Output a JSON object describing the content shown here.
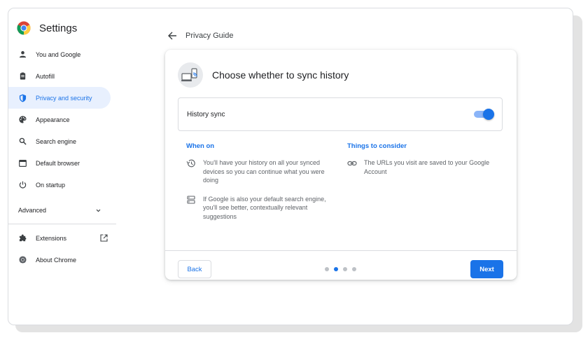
{
  "app": {
    "title": "Settings"
  },
  "sidebar": {
    "items": [
      {
        "label": "You and Google",
        "icon": "person-icon",
        "active": false
      },
      {
        "label": "Autofill",
        "icon": "clipboard-icon",
        "active": false
      },
      {
        "label": "Privacy and security",
        "icon": "shield-icon",
        "active": true
      },
      {
        "label": "Appearance",
        "icon": "palette-icon",
        "active": false
      },
      {
        "label": "Search engine",
        "icon": "search-icon",
        "active": false
      },
      {
        "label": "Default browser",
        "icon": "browser-icon",
        "active": false
      },
      {
        "label": "On startup",
        "icon": "power-icon",
        "active": false
      }
    ],
    "advanced_label": "Advanced",
    "extensions_label": "Extensions",
    "about_label": "About Chrome"
  },
  "breadcrumb": {
    "title": "Privacy Guide"
  },
  "card": {
    "title": "Choose whether to sync history",
    "toggle": {
      "label": "History sync",
      "on": true
    },
    "when_on": {
      "heading": "When on",
      "points": [
        {
          "icon": "history-icon",
          "text": "You'll have your history on all your synced devices so you can continue what you were doing"
        },
        {
          "icon": "search-engine-icon",
          "text": "If Google is also your default search engine, you'll see better, contextually relevant suggestions"
        }
      ]
    },
    "consider": {
      "heading": "Things to consider",
      "points": [
        {
          "icon": "link-icon",
          "text": "The URLs you visit are saved to your Google Account"
        }
      ]
    },
    "footer": {
      "back_label": "Back",
      "next_label": "Next",
      "step_current": 2,
      "step_total": 4
    }
  },
  "colors": {
    "accent": "#1a73e8",
    "active_bg": "#e8f0fe",
    "text": "#202124",
    "muted": "#5f6368"
  }
}
